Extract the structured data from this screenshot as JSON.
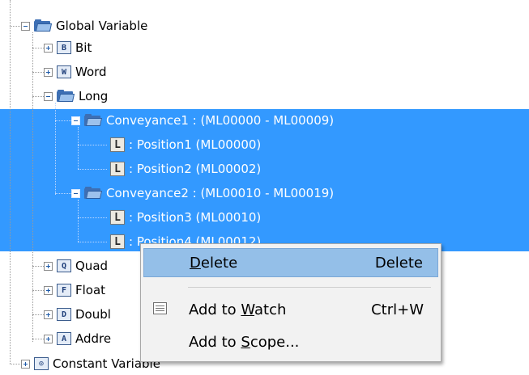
{
  "tree": {
    "items": [
      {
        "id": "global-variable",
        "label": "Global Variable",
        "icon": "folder-icon",
        "expander": "minus"
      },
      {
        "id": "bit",
        "label": "Bit",
        "icon": "B",
        "expander": "plus"
      },
      {
        "id": "word",
        "label": "Word",
        "icon": "W",
        "expander": "plus"
      },
      {
        "id": "long",
        "label": "Long",
        "icon": "folder-icon",
        "expander": "minus"
      },
      {
        "id": "conveyance1",
        "label": "Conveyance1 : (ML00000 - ML00009)",
        "icon": "folder-icon",
        "expander": "minus",
        "selected": true
      },
      {
        "id": "position1",
        "label": ": Position1 (ML00000)",
        "icon": "L",
        "selected": true
      },
      {
        "id": "position2",
        "label": ": Position2 (ML00002)",
        "icon": "L",
        "selected": true
      },
      {
        "id": "conveyance2",
        "label": "Conveyance2 : (ML00010 - ML00019)",
        "icon": "folder-icon",
        "expander": "minus",
        "selected": true
      },
      {
        "id": "position3",
        "label": ": Position3 (ML00010)",
        "icon": "L",
        "selected": true
      },
      {
        "id": "position4",
        "label": ": Position4 (ML00012)",
        "icon": "L",
        "selected": true
      },
      {
        "id": "quad",
        "label": "Quad",
        "icon": "Q",
        "expander": "plus"
      },
      {
        "id": "float",
        "label": "Float",
        "icon": "F",
        "expander": "plus"
      },
      {
        "id": "double",
        "label": "Doubl",
        "icon": "D",
        "expander": "plus"
      },
      {
        "id": "address",
        "label": "Addre",
        "icon": "A",
        "expander": "plus"
      },
      {
        "id": "constant-variable",
        "label": "Constant Variable",
        "icon": "constant-icon",
        "expander": "plus"
      }
    ]
  },
  "context_menu": {
    "items": [
      {
        "label_pre": "",
        "label_mnemonic": "D",
        "label_post": "elete",
        "shortcut": "Delete",
        "highlighted": true
      },
      {
        "label_pre": "Add to ",
        "label_mnemonic": "W",
        "label_post": "atch",
        "shortcut": "Ctrl+W",
        "icon": "watch-icon"
      },
      {
        "label_pre": "Add to ",
        "label_mnemonic": "S",
        "label_post": "cope...",
        "shortcut": ""
      }
    ]
  },
  "colors": {
    "selection": "#3399ff",
    "menu_highlight": "#94bfe8"
  }
}
